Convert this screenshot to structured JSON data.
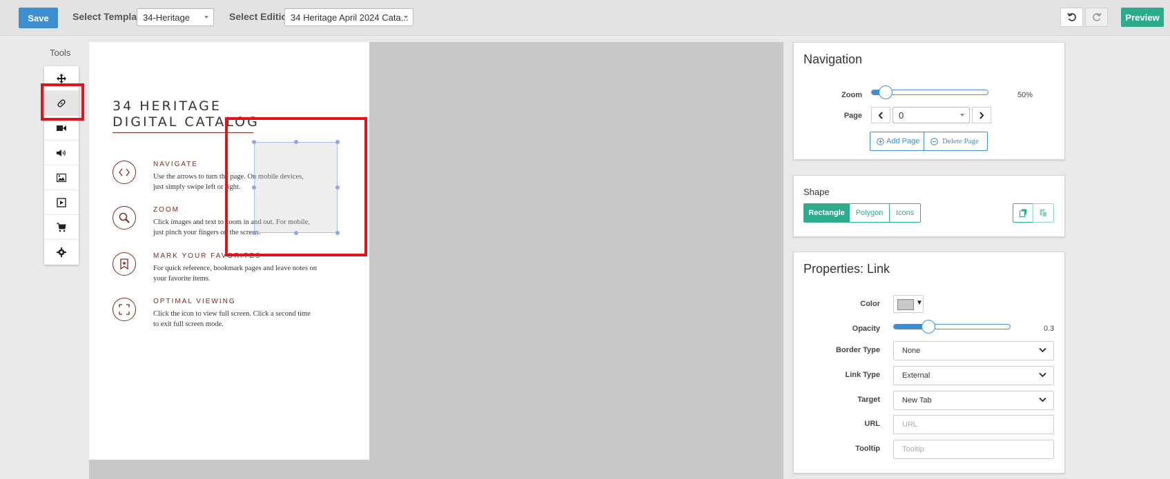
{
  "toolbar": {
    "save_label": "Save",
    "template_label": "Select Template",
    "template_value": "34-Heritage",
    "edition_label": "Select Edition",
    "edition_value": "34 Heritage April 2024 Cata...",
    "preview_label": "Preview"
  },
  "tools": {
    "title": "Tools",
    "items": [
      "move-icon",
      "link-icon",
      "video-icon",
      "audio-icon",
      "image-icon",
      "slideshow-icon",
      "cart-icon",
      "settings-icon"
    ],
    "active": "link-icon"
  },
  "page": {
    "title_line1": "34 HERITAGE",
    "title_line2": "DIGITAL CATALOG",
    "features": [
      {
        "title": "NAVIGATE",
        "line1": "Use the arrows to turn the page. On mobile devices,",
        "line2": "just simply swipe left or right.",
        "icon": "arrows-icon"
      },
      {
        "title": "ZOOM",
        "line1": "Click images and  text to zoom in and out. For mobile,",
        "line2": "just pinch your fingers on the screen.",
        "icon": "magnifier-icon"
      },
      {
        "title": "MARK YOUR FAVORITES",
        "line1": "For quick reference, bookmark pages and leave notes on",
        "line2": "your favorite items.",
        "icon": "bookmark-icon"
      },
      {
        "title": "OPTIMAL VIEWING",
        "line1": "Click the icon to view full screen. Click a second time",
        "line2": "to exit full screen mode.",
        "icon": "fullscreen-icon"
      }
    ]
  },
  "navigation": {
    "title": "Navigation",
    "zoom_label": "Zoom",
    "zoom_value": "50%",
    "zoom_fraction": 0.12,
    "page_label": "Page",
    "page_value": "0",
    "add_page": "Add Page",
    "delete_page": "Delete Page"
  },
  "shape": {
    "title": "Shape",
    "options": [
      "Rectangle",
      "Polygon",
      "Icons"
    ],
    "selected": "Rectangle"
  },
  "properties": {
    "title": "Properties: Link",
    "color_label": "Color",
    "color_value": "#c8c8c8",
    "opacity_label": "Opacity",
    "opacity_value": "0.3",
    "border_type_label": "Border Type",
    "border_type_value": "None",
    "link_type_label": "Link Type",
    "link_type_value": "External",
    "target_label": "Target",
    "target_value": "New Tab",
    "url_label": "URL",
    "url_placeholder": "URL",
    "tooltip_label": "Tooltip",
    "tooltip_placeholder": "Tooltip"
  },
  "colors": {
    "primary": "#3b8fd0",
    "accent": "#2eab8e",
    "brand": "#7a2a1a",
    "highlight": "#e0141c"
  }
}
